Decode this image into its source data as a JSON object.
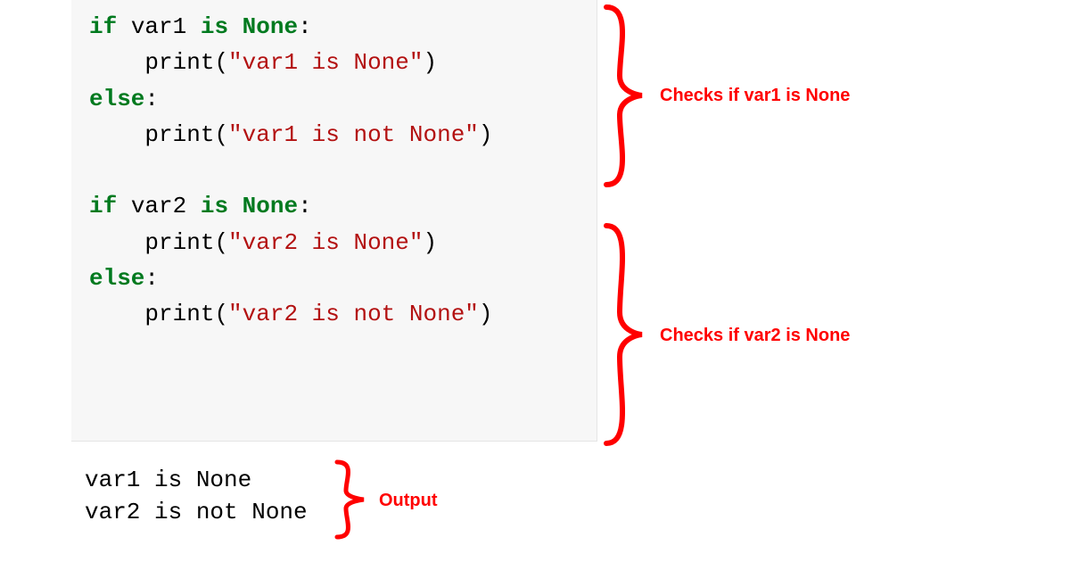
{
  "code": {
    "block1": {
      "line1": {
        "kw1": "if",
        "var": " var1 ",
        "kw2": "is",
        "none": " None",
        "colon": ":"
      },
      "line2": {
        "indent": "    ",
        "fn": "print",
        "open": "(",
        "str": "\"var1 is None\"",
        "close": ")"
      },
      "line3": {
        "kw": "else",
        "colon": ":"
      },
      "line4": {
        "indent": "    ",
        "fn": "print",
        "open": "(",
        "str": "\"var1 is not None\"",
        "close": ")"
      }
    },
    "block2": {
      "line1": {
        "kw1": "if",
        "var": " var2 ",
        "kw2": "is",
        "none": " None",
        "colon": ":"
      },
      "line2": {
        "indent": "    ",
        "fn": "print",
        "open": "(",
        "str": "\"var2 is None\"",
        "close": ")"
      },
      "line3": {
        "kw": "else",
        "colon": ":"
      },
      "line4": {
        "indent": "    ",
        "fn": "print",
        "open": "(",
        "str": "\"var2 is not None\"",
        "close": ")"
      }
    }
  },
  "output": {
    "line1": "var1 is None",
    "line2": "var2 is not None"
  },
  "annotations": {
    "block1": "Checks if var1 is None",
    "block2": "Checks if var2 is None",
    "output": "Output"
  },
  "colors": {
    "annotation": "#ff0000",
    "keyword": "#007a1f",
    "string": "#b31111"
  }
}
